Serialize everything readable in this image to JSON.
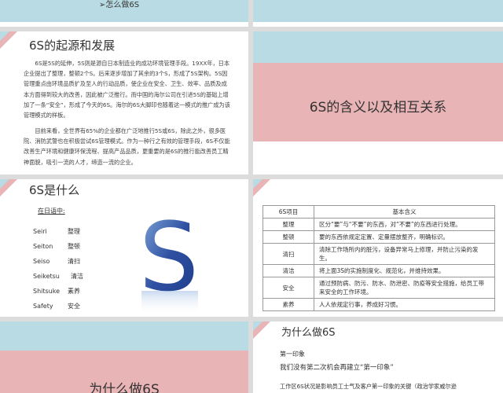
{
  "slides": {
    "s1": {
      "bullet": "➢怎么做6S"
    },
    "s3": {
      "title": "6S的起源和发展",
      "p1": "6S是5S的延伸，5S则是源自日本制造业的成功环境管理手段。19XX年，日本企业提出了整理，整顿2个S。后来逐步增加了其余的3个S，形成了5S架构。5S因管理重点由环境品质扩及至人的行动品质，使企业在安全、卫生、效率、品质及成本方面得到较大的改善，因此被广泛推行。而中国的海尔公司在引进5S的基础上增加了一条“安全”，形成了今天的6S。海尔的6S大脚印也随着这一模式的推广成为该管理模式的样板。",
      "p2": "目前来看，全世界有65%的企业都在广泛地推行5S或6S，除此之外，很多医院、消防武警也在积极尝试6S管理模式。作为一种行之有效的管理手段，6S不仅能改善生产环境和健康环保流程、提高产品品质，更重要的是6S的推行能改善员工精神面貌，吸引一流的人才，缔造一流的企业。"
    },
    "s4": {
      "title": "6S的含义以及相互关系"
    },
    "s5": {
      "title": "6S是什么",
      "subtitle": "在日语中:",
      "terms": [
        {
          "jp": "Seiri",
          "cn": "整理"
        },
        {
          "jp": "Seiton",
          "cn": "整顿"
        },
        {
          "jp": "Seiso",
          "cn": "清扫"
        },
        {
          "jp": "Seiketsu",
          "cn": "清洁"
        },
        {
          "jp": "Shitsuke",
          "cn": "素养"
        },
        {
          "jp": "Safety",
          "cn": "安全"
        }
      ],
      "logo_letter": "S"
    },
    "s6": {
      "headers": [
        "6S项目",
        "基本含义"
      ],
      "rows": [
        {
          "item": "整理",
          "meaning": "区分“要”与“不要”的东西，对“不要”的东西进行处理。"
        },
        {
          "item": "整顿",
          "meaning": "要的东西依规定定置、定量摆放整齐，明确标识。"
        },
        {
          "item": "清扫",
          "meaning": "清除工作场所内的脏污，设备异常马上修理，并防止污染的发生。"
        },
        {
          "item": "清洁",
          "meaning": "将上面3S的实施制度化、规范化，并维持效果。"
        },
        {
          "item": "安全",
          "meaning": "通过预防病、防污、防水、防泄密、防疫等安全措施，给员工带来安全的工作环境。"
        },
        {
          "item": "素养",
          "meaning": "人人依规定行事，养成好习惯。"
        }
      ]
    },
    "s7": {
      "title": "为什么做6S"
    },
    "s8": {
      "title": "为什么做6S",
      "sub": "第一印象",
      "line1": "我们没有第二次机会再建立“第一印象”",
      "line2": "工作区6S状况是影响员工士气及客户第一印象的关键（政治学家威尔逊"
    }
  },
  "colors": {
    "pink": "#e9b4b6",
    "blue": "#b9dbe3",
    "s_dark": "#2e4fa1",
    "s_light": "#8ab2e0"
  }
}
